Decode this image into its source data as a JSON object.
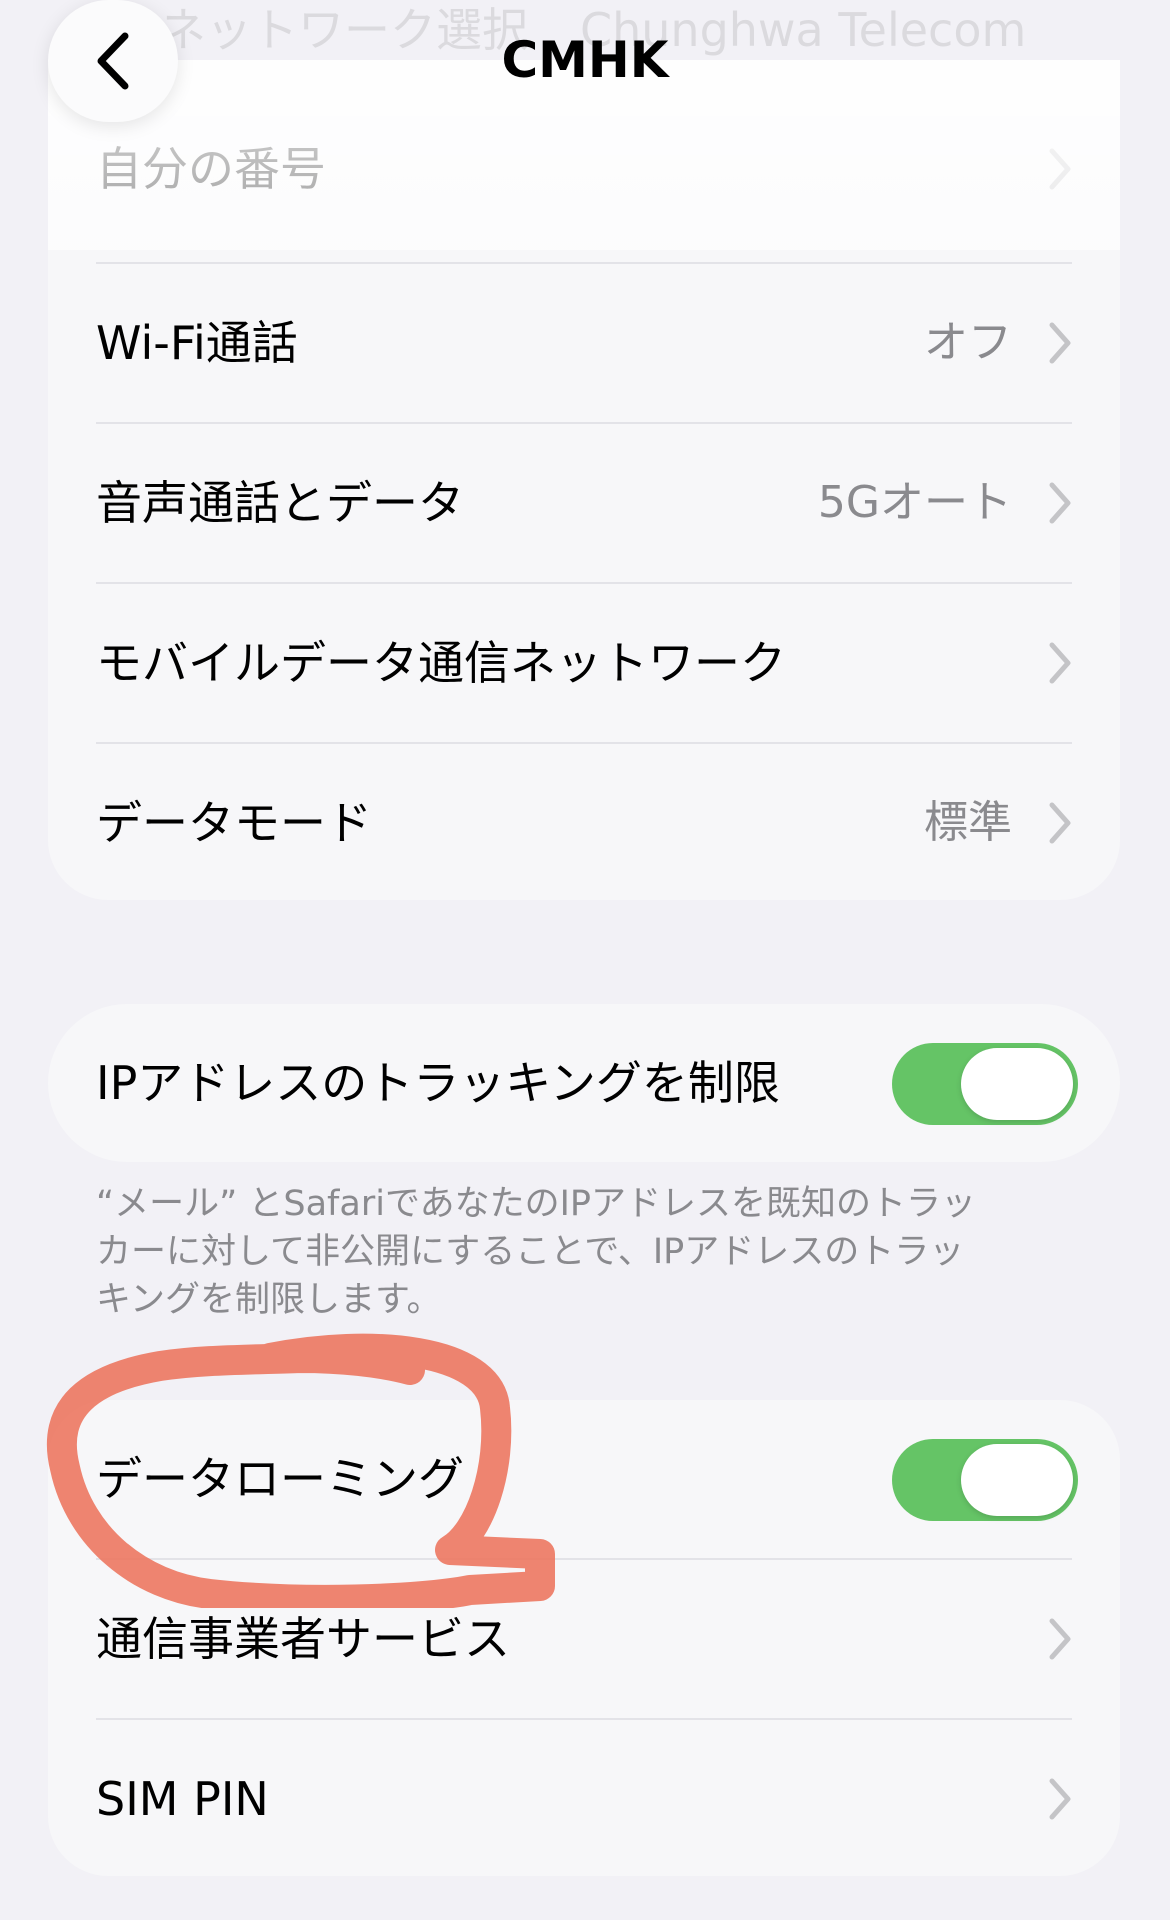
{
  "nav": {
    "title": "CMHK",
    "ghost_label": "ネットワーク選択",
    "ghost_value": "Chunghwa Telecom"
  },
  "group1": {
    "rows": [
      {
        "label": "自分の番号",
        "value": ""
      },
      {
        "label": "Wi-Fi通話",
        "value": "オフ"
      },
      {
        "label": "音声通話とデータ",
        "value": "5Gオート"
      },
      {
        "label": "モバイルデータ通信ネットワーク",
        "value": ""
      },
      {
        "label": "データモード",
        "value": "標準"
      }
    ]
  },
  "group2": {
    "label": "IPアドレスのトラッキングを制限",
    "toggle_on": true,
    "footnote": "“メール” とSafariであなたのIPアドレスを既知のトラッカーに対して非公開にすることで、IPアドレスのトラッキングを制限します。"
  },
  "group3": {
    "rows": [
      {
        "label": "データローミング",
        "toggle_on": true
      },
      {
        "label": "通信事業者サービス"
      },
      {
        "label": "SIM PIN"
      }
    ]
  },
  "colors": {
    "background": "#f2f1f6",
    "cell": "#f7f7f9",
    "toggle_green": "#65c466",
    "secondary_text": "#8a8a8e",
    "annotation": "#ec7760"
  }
}
